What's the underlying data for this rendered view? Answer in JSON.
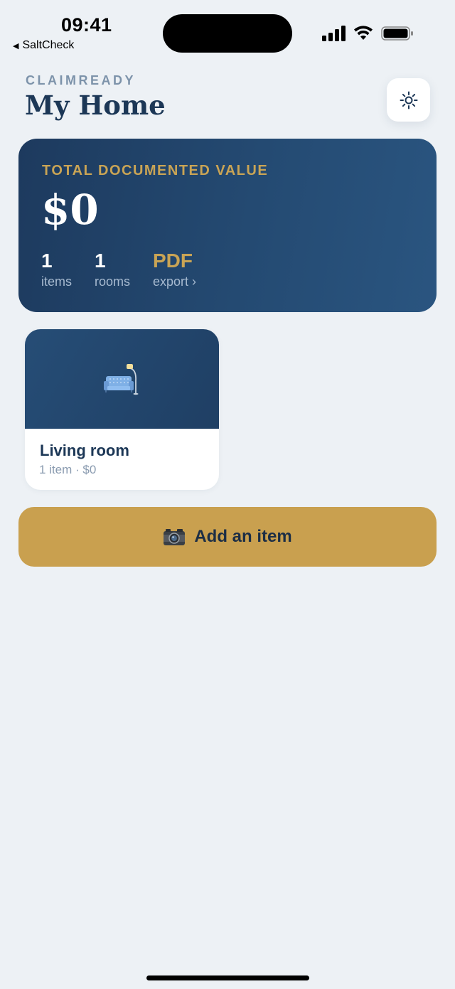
{
  "status_bar": {
    "time": "09:41",
    "back_app": "SaltCheck"
  },
  "header": {
    "brand": "CLAIMREADY",
    "title": "My Home",
    "theme_icon": "sun-icon"
  },
  "summary": {
    "label": "TOTAL DOCUMENTED VALUE",
    "value": "$0",
    "stats": [
      {
        "number": "1",
        "label": "items"
      },
      {
        "number": "1",
        "label": "rooms"
      },
      {
        "number": "PDF",
        "label": "export ›"
      }
    ]
  },
  "rooms": [
    {
      "name": "Living room",
      "meta": "1 item · $0",
      "icon": "sofa-lamp-icon"
    }
  ],
  "actions": {
    "add_item_label": "Add an item",
    "add_item_icon": "camera-icon"
  },
  "colors": {
    "background": "#edf1f5",
    "navy": "#1c3756",
    "gold": "#c9a04f"
  }
}
